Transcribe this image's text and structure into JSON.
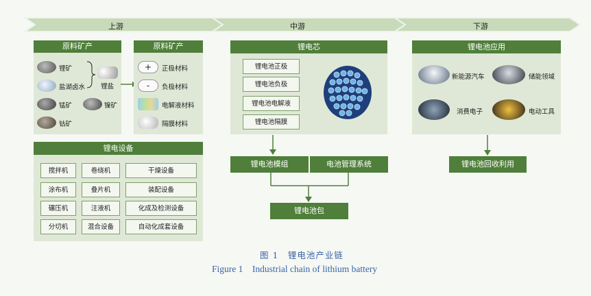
{
  "stages": {
    "upstream": "上游",
    "midstream": "中游",
    "downstream": "下游"
  },
  "raw_minerals": {
    "title": "原料矿产",
    "items": [
      "锂矿",
      "盐湖卤水",
      "锰矿",
      "镍矿",
      "钴矿"
    ],
    "lithium_salt": "锂盐"
  },
  "raw_materials": {
    "title": "原料矿产",
    "items": [
      "正极材料",
      "负极材料",
      "电解液材料",
      "隔膜材料"
    ],
    "symbols": [
      "+",
      "-"
    ]
  },
  "equipment": {
    "title": "锂电设备",
    "items": [
      "搅拌机",
      "卷绕机",
      "干燥设备",
      "涂布机",
      "叠片机",
      "装配设备",
      "碾压机",
      "注液机",
      "化成及检测设备",
      "分切机",
      "混合设备",
      "自动化成套设备"
    ]
  },
  "cell": {
    "title": "锂电芯",
    "items": [
      "锂电池正极",
      "锂电池负极",
      "锂电池电解液",
      "锂电池隔膜"
    ]
  },
  "midstream_flow": {
    "module": "锂电池模组",
    "bms": "电池管理系统",
    "pack": "锂电池包"
  },
  "applications": {
    "title": "锂电池应用",
    "items": [
      "新能源汽车",
      "储能领域",
      "消费电子",
      "电动工具"
    ]
  },
  "recycling": "锂电池回收利用",
  "caption": {
    "cn": "图 1　锂电池产业链",
    "en": "Figure 1    Industrial chain of lithium battery"
  },
  "colors": {
    "green_dark": "#4f7f3a",
    "green_panel": "#dfe8d6",
    "chevron": "#b9cfaa",
    "caption": "#3a64a6"
  }
}
